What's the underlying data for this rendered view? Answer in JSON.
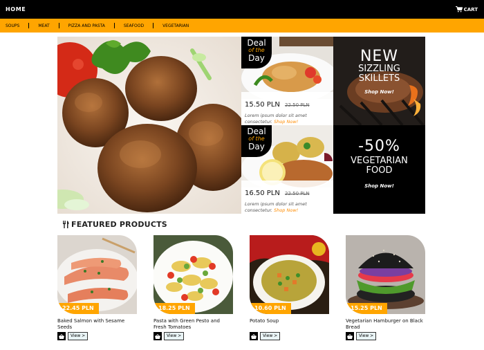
{
  "header": {
    "home_label": "HOME",
    "cart_label": "CART"
  },
  "categories": [
    "SOUPS",
    "MEAT",
    "PIZZA AND PASTA",
    "SEAFOOD",
    "VEGETARIAN"
  ],
  "hero": {
    "deals": [
      {
        "badge_top": "Deal",
        "badge_mid": "of the",
        "badge_bottom": "Day",
        "price": "15.50 PLN",
        "old_price": "22.50 PLN",
        "text": "Lorem ipsum dolor sit amet consectetur.",
        "shop": "Shop Now!"
      },
      {
        "badge_top": "Deal",
        "badge_mid": "of the",
        "badge_bottom": "Day",
        "price": "16.50 PLN",
        "old_price": "22.50 PLN",
        "text": "Lorem ipsum dolor sit amet consectetur.",
        "shop": "Shop Now!"
      }
    ],
    "promo1": {
      "line1": "NEW",
      "line2": "SIZZLING",
      "line3": "SKILLETS",
      "shop": "Shop Now!"
    },
    "promo2": {
      "line1": "-50%",
      "line2": "VEGETARIAN",
      "line3": "FOOD",
      "shop": "Shop Now!"
    }
  },
  "featured": {
    "title": "FEATURED PRODUCTS",
    "view_label": "View >",
    "products": [
      {
        "name": "Baked Salmon with Sesame Seeds",
        "price": "22.45 PLN"
      },
      {
        "name": "Pasta with Green Pesto and Fresh Tomatoes",
        "price": "18.25 PLN"
      },
      {
        "name": "Potato Soup",
        "price": "10.60 PLN"
      },
      {
        "name": "Vegetarian Hamburger on Black Bread",
        "price": "15.25 PLN"
      }
    ]
  },
  "colors": {
    "accent": "#ffa500",
    "topbar": "#000000"
  }
}
